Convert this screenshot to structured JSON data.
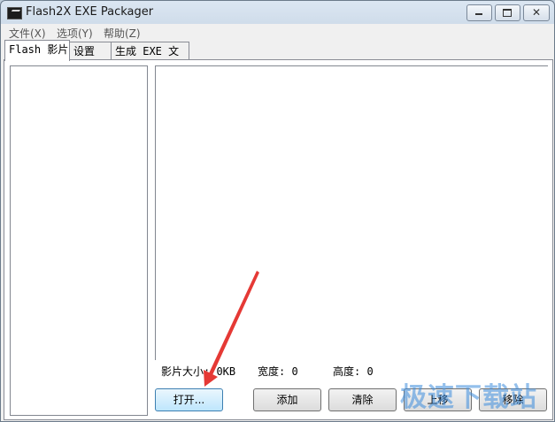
{
  "window": {
    "title": "Flash2X EXE Packager"
  },
  "menu": {
    "items": [
      "文件(X)",
      "选项(Y)",
      "帮助(Z)"
    ]
  },
  "tabs": [
    {
      "label": "Flash 影片",
      "active": true
    },
    {
      "label": "设置",
      "active": false
    },
    {
      "label": "生成 EXE 文件",
      "active": false
    }
  ],
  "info": {
    "size": "影片大小: 0KB",
    "width": "宽度: 0",
    "height": "高度: 0"
  },
  "buttons": {
    "open": "打开...",
    "add": "添加",
    "clear": "清除",
    "move": "上移",
    "remove": "移除"
  },
  "watermark": "极速下载站",
  "colors": {
    "annotation_arrow": "#e53935",
    "watermark": "#3c8cdc"
  }
}
